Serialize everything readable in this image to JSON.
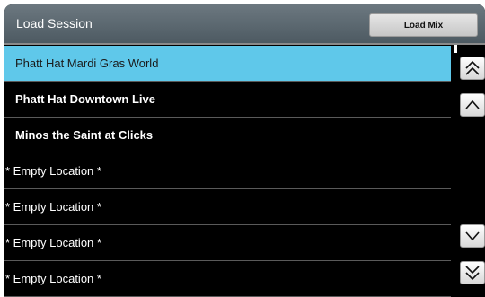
{
  "dialog": {
    "title": "Load Session",
    "load_button": "Load Mix"
  },
  "list": {
    "items": [
      {
        "label": "Phatt Hat Mardi Gras World",
        "selected": true
      },
      {
        "label": "Phatt Hat Downtown Live",
        "selected": false
      },
      {
        "label": "Minos the Saint at Clicks",
        "selected": false
      },
      {
        "label": "* Empty Location *",
        "selected": false
      },
      {
        "label": "* Empty Location *",
        "selected": false
      },
      {
        "label": "* Empty Location *",
        "selected": false
      },
      {
        "label": "* Empty Location *",
        "selected": false
      }
    ]
  },
  "scrollbar": {
    "buttons": [
      "double-chevron-up-icon",
      "chevron-up-icon",
      "chevron-down-icon",
      "double-chevron-down-icon"
    ]
  },
  "colors": {
    "selection": "#5fc8ea",
    "background": "#000000",
    "titlebar": "#5b6870"
  }
}
